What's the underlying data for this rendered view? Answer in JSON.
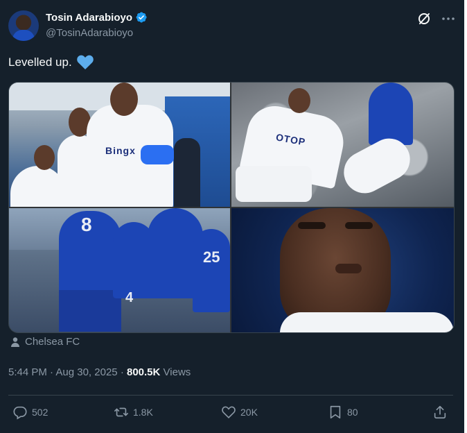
{
  "author": {
    "display_name": "Tosin Adarabioyo",
    "handle": "@TosinAdarabioyo",
    "verified": true
  },
  "tweet": {
    "text": "Levelled up.",
    "emoji": "blue-heart"
  },
  "media": {
    "tiles": [
      {
        "name": "photo-white-kit-players",
        "sponsor": "Bingx"
      },
      {
        "name": "photo-match-challenge",
        "sponsor": "OTOP"
      },
      {
        "name": "photo-players-celebrating",
        "numbers": [
          "8",
          "4",
          "25"
        ]
      },
      {
        "name": "photo-closeup-portrait"
      }
    ]
  },
  "location": {
    "label": "Chelsea FC"
  },
  "meta": {
    "time": "5:44 PM",
    "separator": "·",
    "date": "Aug 30, 2025",
    "views_count": "800.5K",
    "views_label": "Views"
  },
  "actions": {
    "replies": "502",
    "reposts": "1.8K",
    "likes": "20K",
    "bookmarks": "80"
  },
  "colors": {
    "background": "#15202b",
    "text": "#f7f9f9",
    "muted": "#8b98a5",
    "verified": "#1d9bf0",
    "border": "#38444d"
  }
}
